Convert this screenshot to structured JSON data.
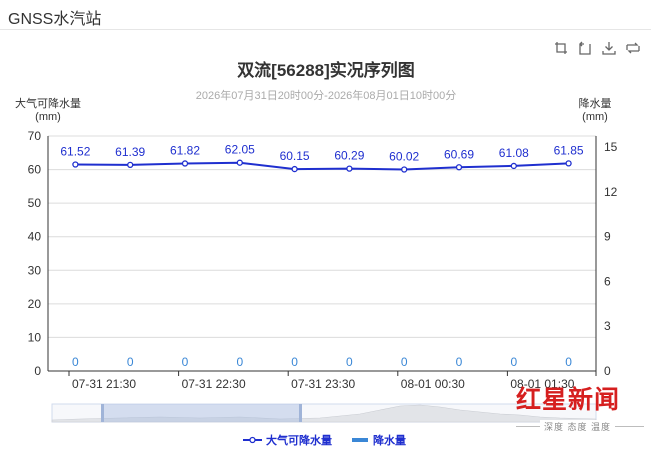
{
  "header": {
    "title": "GNSS水汽站"
  },
  "toolbox": {
    "icons": [
      "zoom-icon",
      "zoom-reset-icon",
      "download-icon",
      "data-view-icon"
    ]
  },
  "chart_data": {
    "type": "line",
    "title": "双流[56288]实况序列图",
    "subtitle": "2026年07月31日20时00分-2026年08月01日10时00分",
    "ylabel_left": "大气可降水量",
    "ylabel_left_unit": "(mm)",
    "ylabel_right": "降水量",
    "ylabel_right_unit": "(mm)",
    "ylim_left": [
      0,
      70
    ],
    "yticks_left": [
      "0",
      "10",
      "20",
      "30",
      "40",
      "50",
      "60",
      "70"
    ],
    "ylim_right": [
      0,
      15.75
    ],
    "yticks_right": [
      "0",
      "3",
      "6",
      "9",
      "12",
      "15"
    ],
    "xticks": [
      "07-31 21:30",
      "07-31 22:30",
      "07-31 23:30",
      "08-01 00:30",
      "08-01 01:30"
    ],
    "series": [
      {
        "name": "大气可降水量",
        "values": [
          61.52,
          61.39,
          61.82,
          62.05,
          60.15,
          60.29,
          60.02,
          60.69,
          61.08,
          61.85
        ],
        "labels": [
          "61.52",
          "61.39",
          "61.82",
          "62.05",
          "60.15",
          "60.29",
          "60.02",
          "60.69",
          "61.08",
          "61.85"
        ],
        "color": "#1f2fcf"
      },
      {
        "name": "降水量",
        "values": [
          0,
          0,
          0,
          0,
          0,
          0,
          0,
          0,
          0,
          0
        ],
        "labels": [
          "0",
          "0",
          "0",
          "0",
          "0",
          "0",
          "0",
          "0",
          "0",
          "0"
        ],
        "color": "#3a87d6"
      }
    ],
    "grid": true,
    "legend": "bottom-center"
  },
  "watermark": {
    "main": "红星新闻",
    "sub": "深度 态度 温度"
  }
}
